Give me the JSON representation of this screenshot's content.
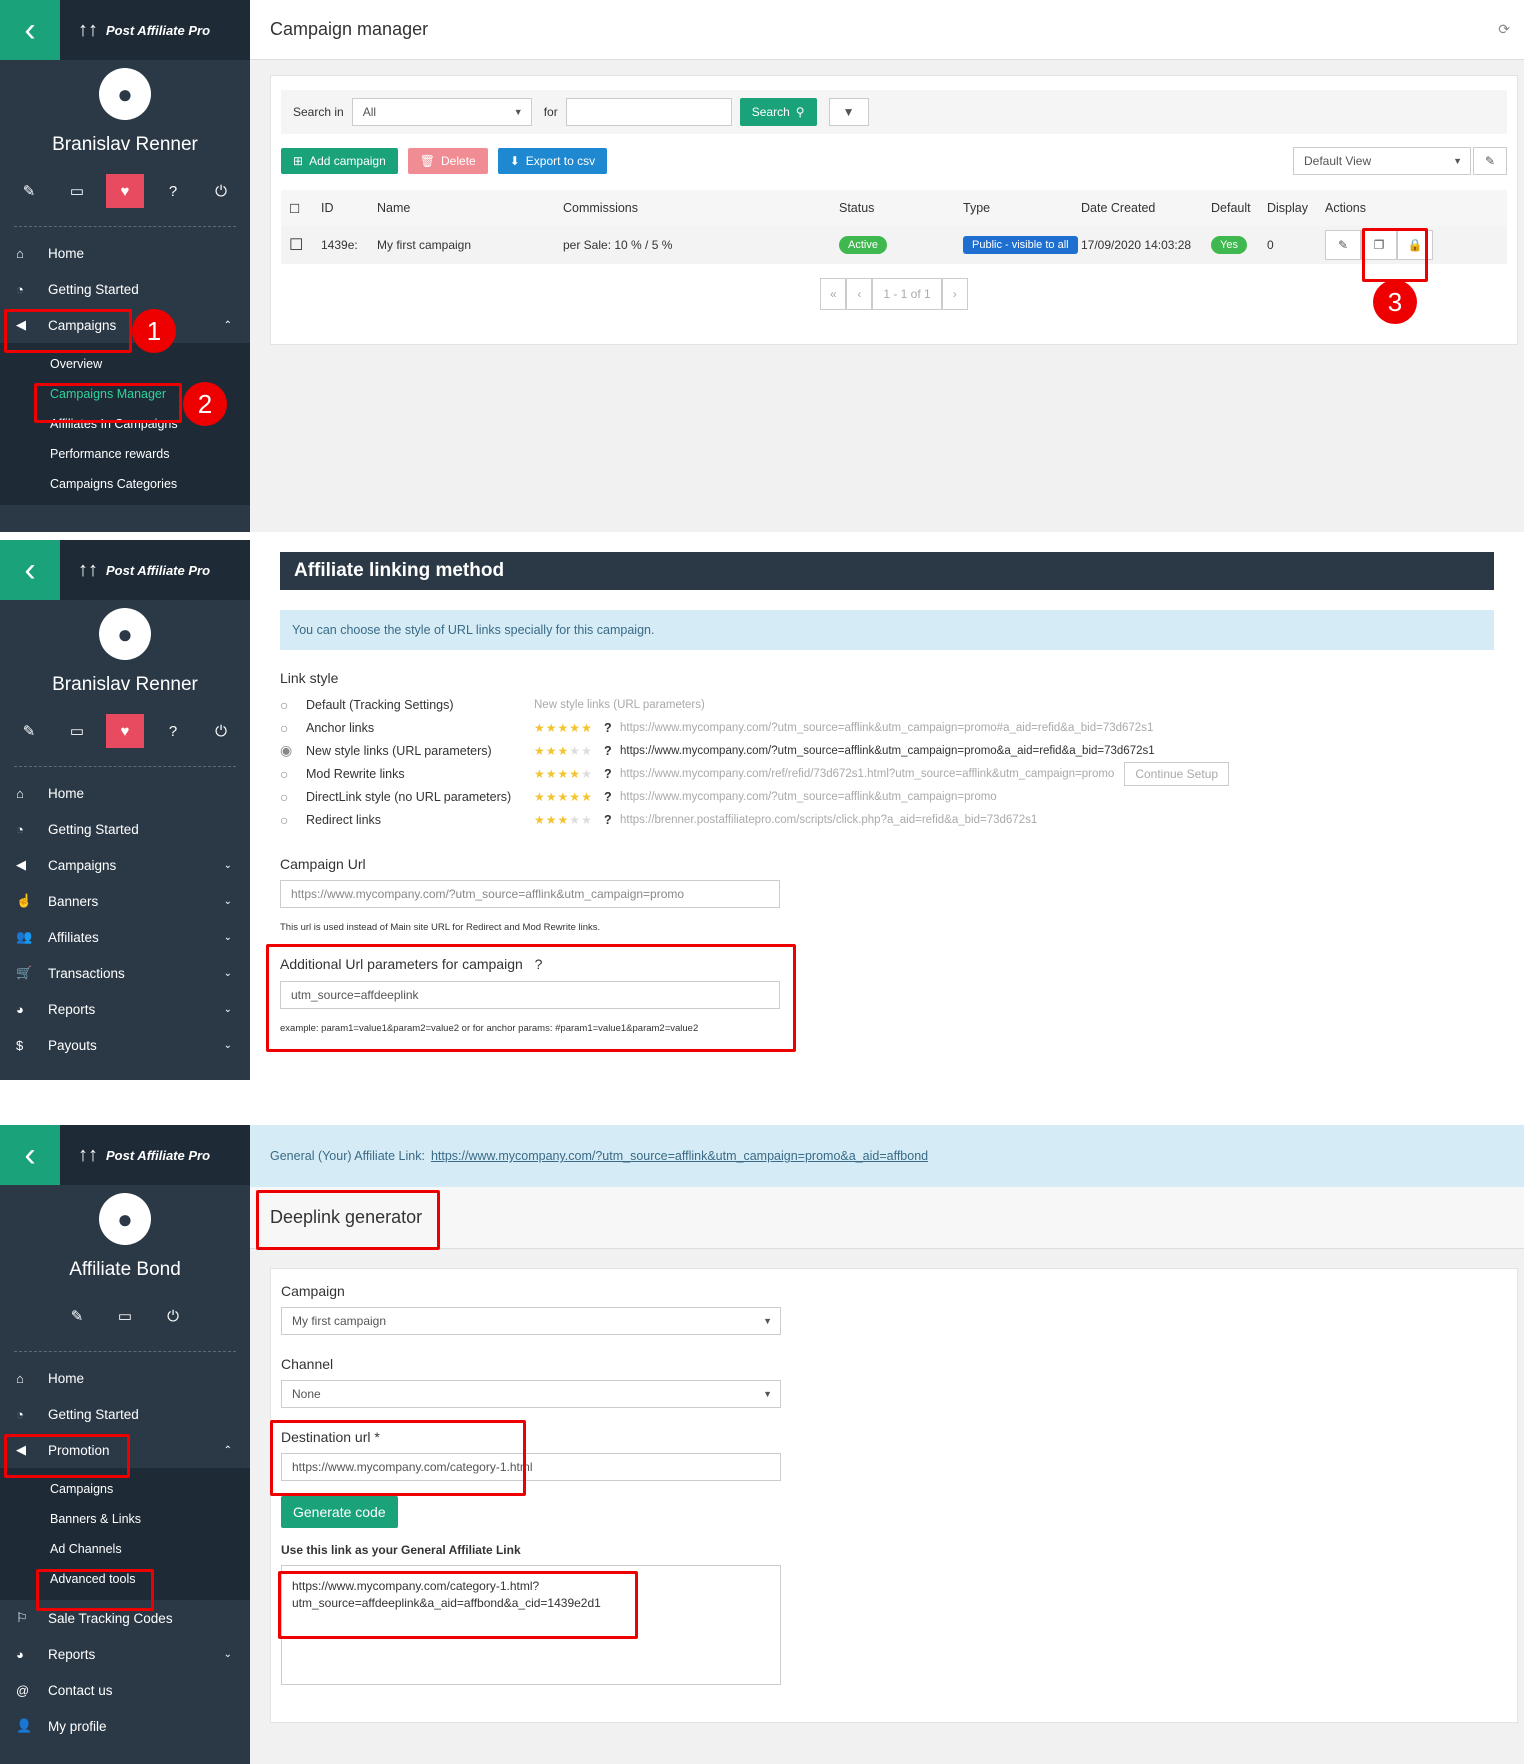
{
  "brand": {
    "name": "Post Affiliate Pro"
  },
  "p1": {
    "user": "Branislav Renner",
    "nav": {
      "home": "Home",
      "getting_started": "Getting Started",
      "campaigns": "Campaigns"
    },
    "sub": [
      "Overview",
      "Campaigns Manager",
      "Affiliates In Campaigns",
      "Performance rewards",
      "Campaigns Categories"
    ],
    "header": "Campaign manager",
    "search": {
      "label": "Search in",
      "select": "All",
      "for": "for",
      "button": "Search"
    },
    "buttons": {
      "add": "Add campaign",
      "delete": "Delete",
      "export": "Export to csv"
    },
    "view": "Default View",
    "columns": [
      "ID",
      "Name",
      "Commissions",
      "Status",
      "Type",
      "Date Created",
      "Default",
      "Display",
      "Actions"
    ],
    "row": {
      "id": "1439e:",
      "name": "My first campaign",
      "commission": "per Sale: 10 % / 5 %",
      "status": "Active",
      "type": "Public - visible to all",
      "date": "17/09/2020 14:03:28",
      "default": "Yes",
      "display": "0"
    },
    "pager": {
      "first": "«",
      "prev": "‹",
      "text": "1 - 1 of 1",
      "next": "›"
    },
    "steps": [
      "1",
      "2",
      "3"
    ]
  },
  "p2": {
    "user": "Branislav Renner",
    "nav": {
      "home": "Home",
      "getting_started": "Getting Started",
      "campaigns": "Campaigns",
      "banners": "Banners",
      "affiliates": "Affiliates",
      "transactions": "Transactions",
      "reports": "Reports",
      "payouts": "Payouts"
    },
    "title": "Affiliate linking method",
    "info": "You can choose the style of URL links specially for this campaign.",
    "link_style_label": "Link style",
    "options": [
      {
        "label": "Default (Tracking Settings)",
        "example": "New style links (URL parameters)",
        "stars": 0,
        "selected": false
      },
      {
        "label": "Anchor links",
        "example": "https://www.mycompany.com/?utm_source=afflink&utm_campaign=promo#a_aid=refid&a_bid=73d672s1",
        "stars": 5,
        "selected": false
      },
      {
        "label": "New style links (URL parameters)",
        "example": "https://www.mycompany.com/?utm_source=afflink&utm_campaign=promo&a_aid=refid&a_bid=73d672s1",
        "stars": 3,
        "selected": true
      },
      {
        "label": "Mod Rewrite links",
        "example": "https://www.mycompany.com/ref/refid/73d672s1.html?utm_source=afflink&utm_campaign=promo",
        "stars": 4,
        "selected": false,
        "extra": "Continue Setup"
      },
      {
        "label": "DirectLink style (no URL parameters)",
        "example": "https://www.mycompany.com/?utm_source=afflink&utm_campaign=promo",
        "stars": 5,
        "selected": false
      },
      {
        "label": "Redirect links",
        "example": "https://brenner.postaffiliatepro.com/scripts/click.php?a_aid=refid&a_bid=73d672s1",
        "stars": 3,
        "selected": false
      }
    ],
    "campaign_url_label": "Campaign Url",
    "campaign_url": "https://www.mycompany.com/?utm_source=afflink&utm_campaign=promo",
    "campaign_url_hint": "This url is used instead of Main site URL for Redirect and Mod Rewrite links.",
    "add_params_label": "Additional Url parameters for campaign",
    "add_params_value": "utm_source=affdeeplink",
    "add_params_hint": "example: param1=value1&param2=value2 or for anchor params: #param1=value1&param2=value2"
  },
  "p3": {
    "user": "Affiliate Bond",
    "nav": {
      "home": "Home",
      "getting_started": "Getting Started",
      "promotion": "Promotion",
      "sale_tracking": "Sale Tracking Codes",
      "reports": "Reports",
      "contact": "Contact us",
      "profile": "My profile"
    },
    "sub": [
      "Campaigns",
      "Banners & Links",
      "Ad Channels",
      "Advanced tools"
    ],
    "general_label": "General (Your) Affiliate Link:",
    "general_link": "https://www.mycompany.com/?utm_source=afflink&utm_campaign=promo&a_aid=affbond",
    "header": "Deeplink generator",
    "campaign_label": "Campaign",
    "campaign_value": "My first campaign",
    "channel_label": "Channel",
    "channel_value": "None",
    "dest_label": "Destination url *",
    "dest_value": "https://www.mycompany.com/category-1.html",
    "generate": "Generate code",
    "use_label": "Use this link as your General Affiliate Link",
    "result": "https://www.mycompany.com/category-1.html?\nutm_source=affdeeplink&a_aid=affbond&a_cid=1439e2d1"
  }
}
